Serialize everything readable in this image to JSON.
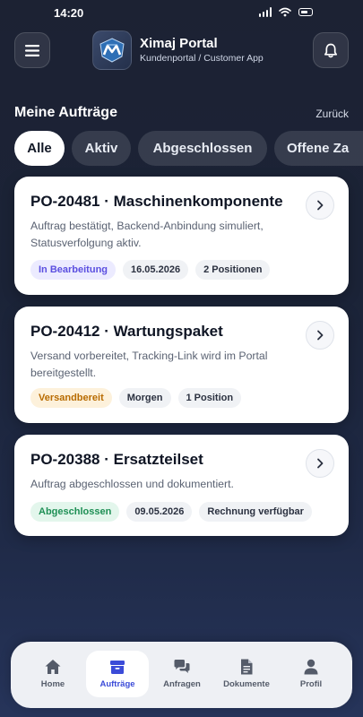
{
  "status_bar": {
    "time": "14:20"
  },
  "header": {
    "app_title": "Ximaj Portal",
    "app_subtitle": "Kundenportal / Customer App"
  },
  "section": {
    "title": "Meine Aufträge",
    "back_label": "Zurück"
  },
  "filters": [
    {
      "label": "Alle",
      "active": true
    },
    {
      "label": "Aktiv",
      "active": false
    },
    {
      "label": "Abgeschlossen",
      "active": false
    },
    {
      "label": "Offene Za",
      "active": false
    }
  ],
  "orders": [
    {
      "title": "PO-20481 · Maschinenkomponente",
      "description": "Auftrag bestätigt, Backend-Anbindung simuliert, Statusverfolgung aktiv.",
      "status": "In Bearbeitung",
      "date": "16.05.2026",
      "extra": "2 Positionen"
    },
    {
      "title": "PO-20412 · Wartungspaket",
      "description": "Versand vorbereitet, Tracking-Link wird im Portal bereitgestellt.",
      "status": "Versandbereit",
      "date": "Morgen",
      "extra": "1 Position"
    },
    {
      "title": "PO-20388 · Ersatzteilset",
      "description": "Auftrag abgeschlossen und dokumentiert.",
      "status": "Abgeschlossen",
      "date": "09.05.2026",
      "extra": "Rechnung verfügbar"
    }
  ],
  "bottom_nav": [
    {
      "label": "Home",
      "icon": "home-icon"
    },
    {
      "label": "Aufträge",
      "icon": "box-icon",
      "active": true
    },
    {
      "label": "Anfragen",
      "icon": "chat-bubbles-icon"
    },
    {
      "label": "Dokumente",
      "icon": "document-icon"
    },
    {
      "label": "Profil",
      "icon": "person-icon"
    }
  ],
  "colors": {
    "accent": "#3b4bd8",
    "status_progress": "#5b4fe0",
    "status_ready": "#b86b00",
    "status_done": "#1e8f55"
  }
}
